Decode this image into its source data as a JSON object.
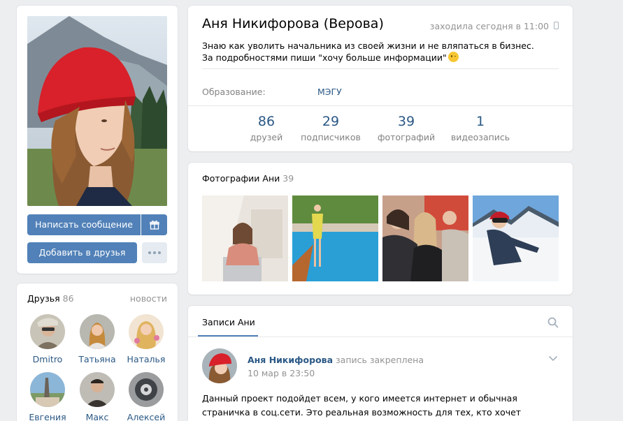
{
  "profile": {
    "name": "Аня Никифорова (Верова)",
    "last_seen": "заходила сегодня в 11:00",
    "status": "Знаю как уволить начальника из своей жизни и не вляпаться в бизнес. За подробностями пиши \"хочу больше информации\"",
    "education_label": "Образование:",
    "education_value": "МЭГУ"
  },
  "actions": {
    "message": "Написать сообщение",
    "add_friend": "Добавить в друзья"
  },
  "stats": [
    {
      "count": "86",
      "label": "друзей"
    },
    {
      "count": "29",
      "label": "подписчиков"
    },
    {
      "count": "39",
      "label": "фотографий"
    },
    {
      "count": "1",
      "label": "видеозапись"
    }
  ],
  "friends": {
    "title": "Друзья",
    "count": "86",
    "news_link": "новости",
    "items": [
      {
        "name": "Dmitro"
      },
      {
        "name": "Татьяна"
      },
      {
        "name": "Наталья"
      },
      {
        "name": "Евгения"
      },
      {
        "name": "Макс"
      },
      {
        "name": "Алексей"
      }
    ]
  },
  "photos": {
    "title": "Фотографии Ани",
    "count": "39"
  },
  "wall": {
    "tab": "Записи Ани",
    "post": {
      "author": "Аня Никифорова",
      "pinned": "запись закреплена",
      "date": "10 мар в 23:50",
      "text": "Данный проект подойдет всем, у кого имеется интернет и обычная страничка в соц.сети. Это реальная возможность для тех, кто хочет получить новые"
    }
  },
  "colors": {
    "accent": "#5181b8",
    "link": "#2a5885",
    "page_bg": "#edeef0"
  }
}
